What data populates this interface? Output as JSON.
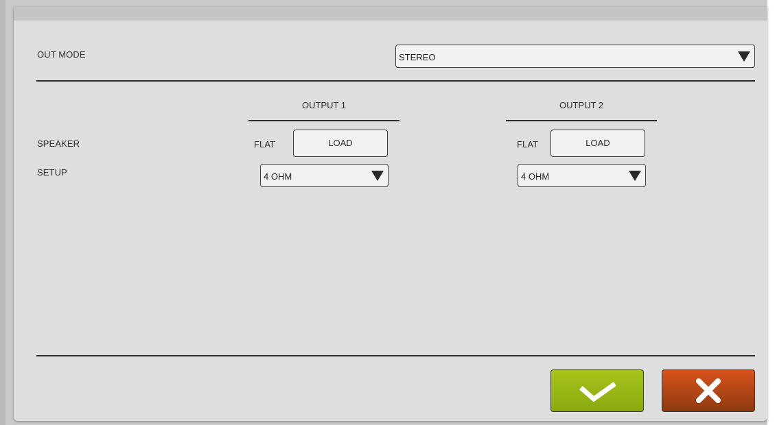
{
  "out_mode": {
    "label": "OUT MODE",
    "value": "STEREO"
  },
  "outputs": [
    {
      "heading": "OUTPUT 1",
      "flat_label": "FLAT",
      "load_label": "LOAD",
      "impedance": "4 OHM"
    },
    {
      "heading": "OUTPUT 2",
      "flat_label": "FLAT",
      "load_label": "LOAD",
      "impedance": "4 OHM"
    }
  ],
  "labels": {
    "speaker": "SPEAKER",
    "setup": "SETUP"
  },
  "icons": {
    "confirm": "checkmark-icon",
    "cancel": "x-close-icon",
    "dropdown": "triangle-down-icon"
  },
  "colors": {
    "confirm_button": "#9ab615",
    "cancel_button": "#c24a18",
    "dialog_background": "#dedede"
  }
}
